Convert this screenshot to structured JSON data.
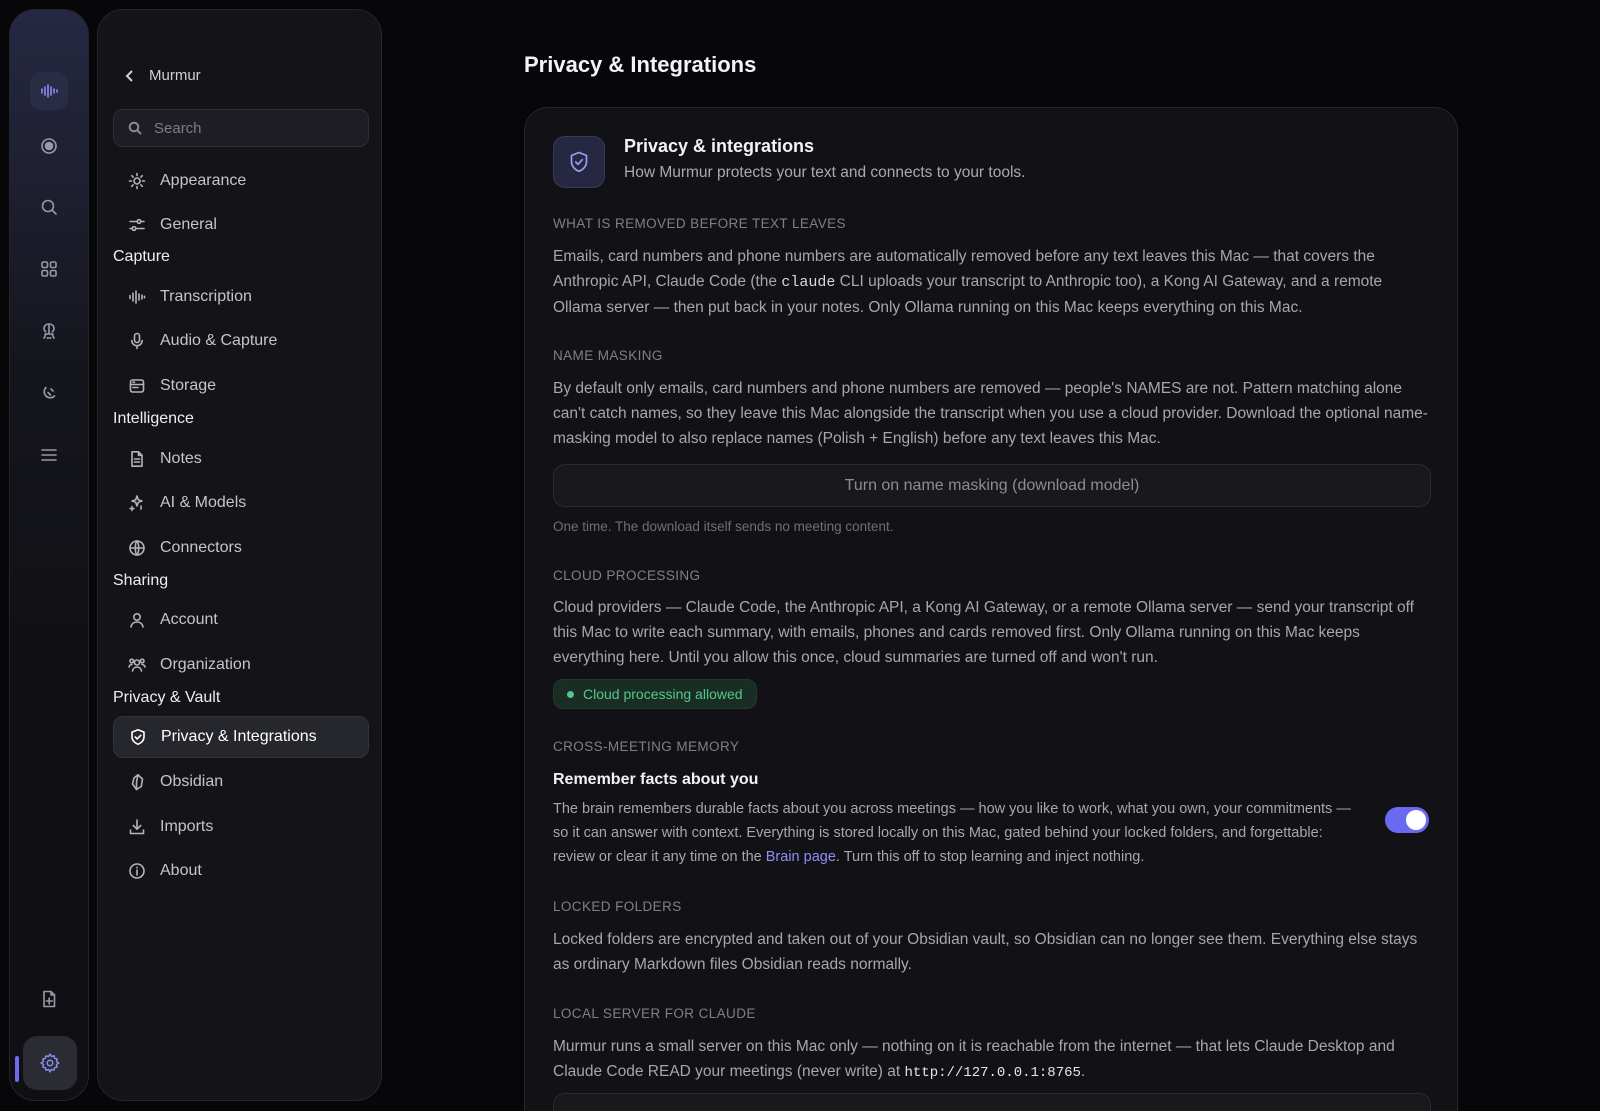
{
  "rail": {
    "items": [
      "waveform-icon",
      "record-icon",
      "search-icon",
      "grid-icon",
      "brain-icon",
      "tag-icon",
      "list-icon",
      "new-note-icon",
      "settings-icon"
    ]
  },
  "nav": {
    "back_label": "Murmur",
    "search_placeholder": "Search",
    "items_top": [
      {
        "label": "Appearance",
        "icon": "sun-icon"
      },
      {
        "label": "General",
        "icon": "sliders-icon"
      }
    ],
    "capture": {
      "title": "Capture",
      "items": [
        {
          "label": "Transcription",
          "icon": "waveform-icon"
        },
        {
          "label": "Audio & Capture",
          "icon": "microphone-icon"
        },
        {
          "label": "Storage",
          "icon": "storage-icon"
        }
      ]
    },
    "intelligence": {
      "title": "Intelligence",
      "items": [
        {
          "label": "Notes",
          "icon": "document-icon"
        },
        {
          "label": "AI & Models",
          "icon": "sparkle-icon"
        },
        {
          "label": "Connectors",
          "icon": "globe-icon"
        }
      ]
    },
    "sharing": {
      "title": "Sharing",
      "items": [
        {
          "label": "Account",
          "icon": "user-icon"
        },
        {
          "label": "Organization",
          "icon": "users-icon"
        }
      ]
    },
    "privacy": {
      "title": "Privacy & Vault",
      "items": [
        {
          "label": "Privacy & Integrations",
          "icon": "shield-check-icon",
          "active": true
        },
        {
          "label": "Obsidian",
          "icon": "obsidian-icon"
        },
        {
          "label": "Imports",
          "icon": "download-icon"
        },
        {
          "label": "About",
          "icon": "info-icon"
        }
      ]
    }
  },
  "main": {
    "page_title": "Privacy & Integrations",
    "card_title": "Privacy & integrations",
    "card_subtitle": "How Murmur protects your text and connects to your tools.",
    "removed": {
      "label": "WHAT IS REMOVED BEFORE TEXT LEAVES",
      "text_a": "Emails, card numbers and phone numbers are automatically removed before any text leaves this Mac — that covers the Anthropic API, Claude Code (the ",
      "code": "claude",
      "text_b": " CLI uploads your transcript to Anthropic too), a Kong AI Gateway, and a remote Ollama server — then put back in your notes. Only Ollama running on this Mac keeps everything on this Mac."
    },
    "name_masking": {
      "label": "NAME MASKING",
      "text": "By default only emails, card numbers and phone numbers are removed — people's NAMES are not. Pattern matching alone can't catch names, so they leave this Mac alongside the transcript when you use a cloud provider. Download the optional name-masking model to also replace names (Polish + English) before any text leaves this Mac.",
      "button": "Turn on name masking (download model)",
      "hint": "One time. The download itself sends no meeting content."
    },
    "cloud": {
      "label": "CLOUD PROCESSING",
      "text": "Cloud providers — Claude Code, the Anthropic API, a Kong AI Gateway, or a remote Ollama server — send your transcript off this Mac to write each summary, with emails, phones and cards removed first. Only Ollama running on this Mac keeps everything here. Until you allow this once, cloud summaries are turned off and won't run.",
      "status": "Cloud processing allowed",
      "status_color": "#52c98a"
    },
    "memory": {
      "label": "CROSS-MEETING MEMORY",
      "title": "Remember facts about you",
      "text_a": "The brain remembers durable facts about you across meetings — how you like to work, what you own, your commitments — so it can answer with context. Everything is stored locally on this Mac, gated behind your locked folders, and forgettable: review or clear it any time on the ",
      "link": "Brain page",
      "text_b": ". Turn this off to stop learning and inject nothing.",
      "enabled": true,
      "accent": "#6a6af0"
    },
    "locked": {
      "label": "LOCKED FOLDERS",
      "text": "Locked folders are encrypted and taken out of your Obsidian vault, so Obsidian can no longer see them. Everything else stays as ordinary Markdown files Obsidian reads normally."
    },
    "local_server": {
      "label": "LOCAL SERVER FOR CLAUDE",
      "text_a": "Murmur runs a small server on this Mac only — nothing on it is reachable from the internet — that lets Claude Desktop and Claude Code READ your meetings (never write) at ",
      "url": "http://127.0.0.1:8765",
      "text_b": "."
    }
  }
}
